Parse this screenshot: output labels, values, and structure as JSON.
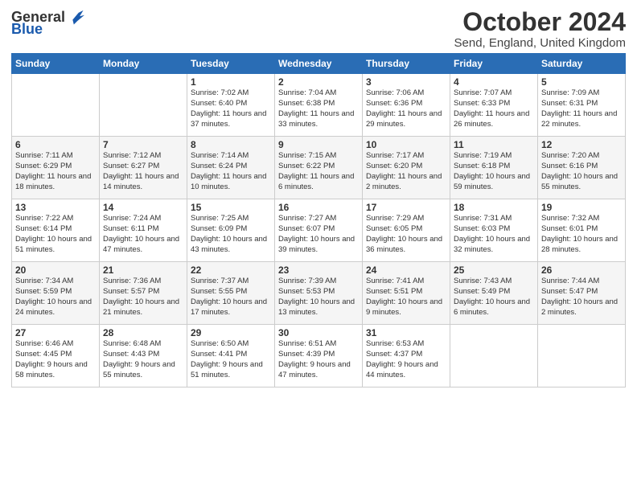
{
  "header": {
    "logo_general": "General",
    "logo_blue": "Blue",
    "title": "October 2024",
    "location": "Send, England, United Kingdom"
  },
  "days_of_week": [
    "Sunday",
    "Monday",
    "Tuesday",
    "Wednesday",
    "Thursday",
    "Friday",
    "Saturday"
  ],
  "weeks": [
    [
      {
        "day": "",
        "detail": ""
      },
      {
        "day": "",
        "detail": ""
      },
      {
        "day": "1",
        "detail": "Sunrise: 7:02 AM\nSunset: 6:40 PM\nDaylight: 11 hours and 37 minutes."
      },
      {
        "day": "2",
        "detail": "Sunrise: 7:04 AM\nSunset: 6:38 PM\nDaylight: 11 hours and 33 minutes."
      },
      {
        "day": "3",
        "detail": "Sunrise: 7:06 AM\nSunset: 6:36 PM\nDaylight: 11 hours and 29 minutes."
      },
      {
        "day": "4",
        "detail": "Sunrise: 7:07 AM\nSunset: 6:33 PM\nDaylight: 11 hours and 26 minutes."
      },
      {
        "day": "5",
        "detail": "Sunrise: 7:09 AM\nSunset: 6:31 PM\nDaylight: 11 hours and 22 minutes."
      }
    ],
    [
      {
        "day": "6",
        "detail": "Sunrise: 7:11 AM\nSunset: 6:29 PM\nDaylight: 11 hours and 18 minutes."
      },
      {
        "day": "7",
        "detail": "Sunrise: 7:12 AM\nSunset: 6:27 PM\nDaylight: 11 hours and 14 minutes."
      },
      {
        "day": "8",
        "detail": "Sunrise: 7:14 AM\nSunset: 6:24 PM\nDaylight: 11 hours and 10 minutes."
      },
      {
        "day": "9",
        "detail": "Sunrise: 7:15 AM\nSunset: 6:22 PM\nDaylight: 11 hours and 6 minutes."
      },
      {
        "day": "10",
        "detail": "Sunrise: 7:17 AM\nSunset: 6:20 PM\nDaylight: 11 hours and 2 minutes."
      },
      {
        "day": "11",
        "detail": "Sunrise: 7:19 AM\nSunset: 6:18 PM\nDaylight: 10 hours and 59 minutes."
      },
      {
        "day": "12",
        "detail": "Sunrise: 7:20 AM\nSunset: 6:16 PM\nDaylight: 10 hours and 55 minutes."
      }
    ],
    [
      {
        "day": "13",
        "detail": "Sunrise: 7:22 AM\nSunset: 6:14 PM\nDaylight: 10 hours and 51 minutes."
      },
      {
        "day": "14",
        "detail": "Sunrise: 7:24 AM\nSunset: 6:11 PM\nDaylight: 10 hours and 47 minutes."
      },
      {
        "day": "15",
        "detail": "Sunrise: 7:25 AM\nSunset: 6:09 PM\nDaylight: 10 hours and 43 minutes."
      },
      {
        "day": "16",
        "detail": "Sunrise: 7:27 AM\nSunset: 6:07 PM\nDaylight: 10 hours and 39 minutes."
      },
      {
        "day": "17",
        "detail": "Sunrise: 7:29 AM\nSunset: 6:05 PM\nDaylight: 10 hours and 36 minutes."
      },
      {
        "day": "18",
        "detail": "Sunrise: 7:31 AM\nSunset: 6:03 PM\nDaylight: 10 hours and 32 minutes."
      },
      {
        "day": "19",
        "detail": "Sunrise: 7:32 AM\nSunset: 6:01 PM\nDaylight: 10 hours and 28 minutes."
      }
    ],
    [
      {
        "day": "20",
        "detail": "Sunrise: 7:34 AM\nSunset: 5:59 PM\nDaylight: 10 hours and 24 minutes."
      },
      {
        "day": "21",
        "detail": "Sunrise: 7:36 AM\nSunset: 5:57 PM\nDaylight: 10 hours and 21 minutes."
      },
      {
        "day": "22",
        "detail": "Sunrise: 7:37 AM\nSunset: 5:55 PM\nDaylight: 10 hours and 17 minutes."
      },
      {
        "day": "23",
        "detail": "Sunrise: 7:39 AM\nSunset: 5:53 PM\nDaylight: 10 hours and 13 minutes."
      },
      {
        "day": "24",
        "detail": "Sunrise: 7:41 AM\nSunset: 5:51 PM\nDaylight: 10 hours and 9 minutes."
      },
      {
        "day": "25",
        "detail": "Sunrise: 7:43 AM\nSunset: 5:49 PM\nDaylight: 10 hours and 6 minutes."
      },
      {
        "day": "26",
        "detail": "Sunrise: 7:44 AM\nSunset: 5:47 PM\nDaylight: 10 hours and 2 minutes."
      }
    ],
    [
      {
        "day": "27",
        "detail": "Sunrise: 6:46 AM\nSunset: 4:45 PM\nDaylight: 9 hours and 58 minutes."
      },
      {
        "day": "28",
        "detail": "Sunrise: 6:48 AM\nSunset: 4:43 PM\nDaylight: 9 hours and 55 minutes."
      },
      {
        "day": "29",
        "detail": "Sunrise: 6:50 AM\nSunset: 4:41 PM\nDaylight: 9 hours and 51 minutes."
      },
      {
        "day": "30",
        "detail": "Sunrise: 6:51 AM\nSunset: 4:39 PM\nDaylight: 9 hours and 47 minutes."
      },
      {
        "day": "31",
        "detail": "Sunrise: 6:53 AM\nSunset: 4:37 PM\nDaylight: 9 hours and 44 minutes."
      },
      {
        "day": "",
        "detail": ""
      },
      {
        "day": "",
        "detail": ""
      }
    ]
  ]
}
